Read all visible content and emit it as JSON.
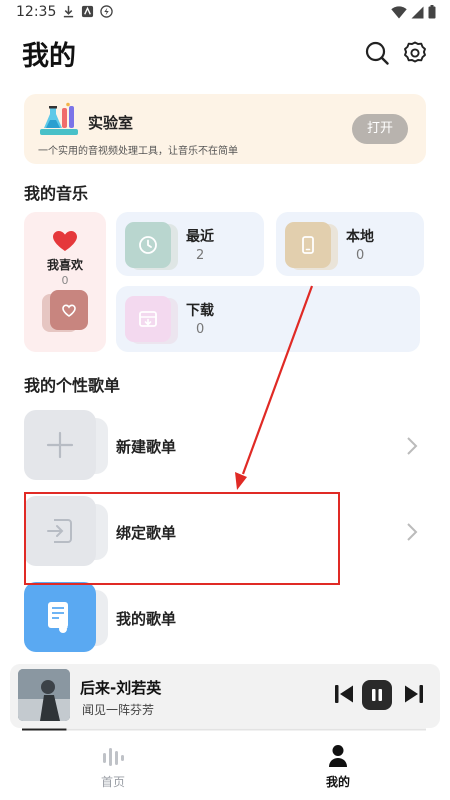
{
  "status_bar": {
    "time": "12:35"
  },
  "header": {
    "title": "我的",
    "icons": [
      "search-icon",
      "settings-icon"
    ]
  },
  "lab": {
    "title": "实验室",
    "description": "一个实用的音视频处理工具，让音乐不在简单",
    "open_label": "打开"
  },
  "my_music": {
    "title": "我的音乐",
    "favorites": {
      "label": "我喜欢",
      "count": "0"
    },
    "tiles": [
      {
        "label": "最近",
        "count": "2",
        "icon": "clock-icon"
      },
      {
        "label": "本地",
        "count": "0",
        "icon": "phone-icon"
      },
      {
        "label": "下载",
        "count": "0",
        "icon": "download-box-icon"
      }
    ]
  },
  "playlists": {
    "title": "我的个性歌单",
    "items": [
      {
        "label": "新建歌单",
        "icon": "plus-icon"
      },
      {
        "label": "绑定歌单",
        "icon": "bind-import-icon"
      },
      {
        "label": "我的歌单",
        "icon": "playlist-note-icon"
      }
    ]
  },
  "player": {
    "song": "后来-刘若英",
    "lyric": "闻见一阵芬芳",
    "progress": 0.11
  },
  "tabs": [
    {
      "label": "首页",
      "active": false
    },
    {
      "label": "我的",
      "active": true
    }
  ],
  "colors": {
    "annotation": "#e02a25",
    "lab_bg": "#fdf3e6",
    "tile_bg": "#eef3fb",
    "favorites_bg": "#fdeeee",
    "heart": "#e5383b",
    "playlist_blue": "#5aa9f2"
  }
}
